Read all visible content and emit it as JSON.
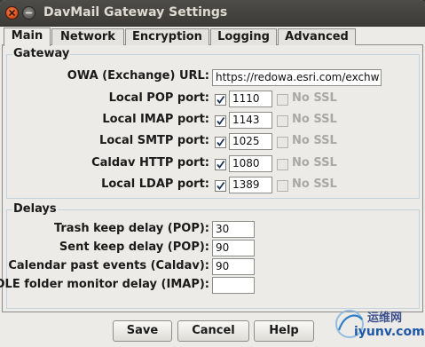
{
  "window": {
    "title": "DavMail Gateway Settings"
  },
  "tabs": [
    {
      "label": "Main",
      "active": true
    },
    {
      "label": "Network"
    },
    {
      "label": "Encryption"
    },
    {
      "label": "Logging"
    },
    {
      "label": "Advanced"
    }
  ],
  "gateway": {
    "title": "Gateway",
    "owa_label": "OWA (Exchange) URL:",
    "owa_value": "https://redowa.esri.com/exchw",
    "no_ssl_label": "No SSL",
    "ports": [
      {
        "label": "Local POP port:",
        "enabled": true,
        "value": "1110",
        "no_ssl": false
      },
      {
        "label": "Local IMAP port:",
        "enabled": true,
        "value": "1143",
        "no_ssl": false
      },
      {
        "label": "Local SMTP port:",
        "enabled": true,
        "value": "1025",
        "no_ssl": false
      },
      {
        "label": "Caldav HTTP port:",
        "enabled": true,
        "value": "1080",
        "no_ssl": false
      },
      {
        "label": "Local LDAP port:",
        "enabled": true,
        "value": "1389",
        "no_ssl": false
      }
    ]
  },
  "delays": {
    "title": "Delays",
    "items": [
      {
        "label": "Trash keep delay (POP):",
        "value": "30"
      },
      {
        "label": "Sent keep delay (POP):",
        "value": "90"
      },
      {
        "label": "Calendar past events (Caldav):",
        "value": "90"
      },
      {
        "label": "IDLE folder monitor delay (IMAP):",
        "value": ""
      }
    ]
  },
  "buttons": {
    "save": "Save",
    "cancel": "Cancel",
    "help": "Help"
  },
  "watermark": {
    "line1": "运维网",
    "line2": "iyunv.com"
  },
  "colors": {
    "titlebar": "#3c3b37",
    "close_button": "#e0602a",
    "window_bg": "#ecebe7",
    "group_border": "#c4d2e0"
  }
}
